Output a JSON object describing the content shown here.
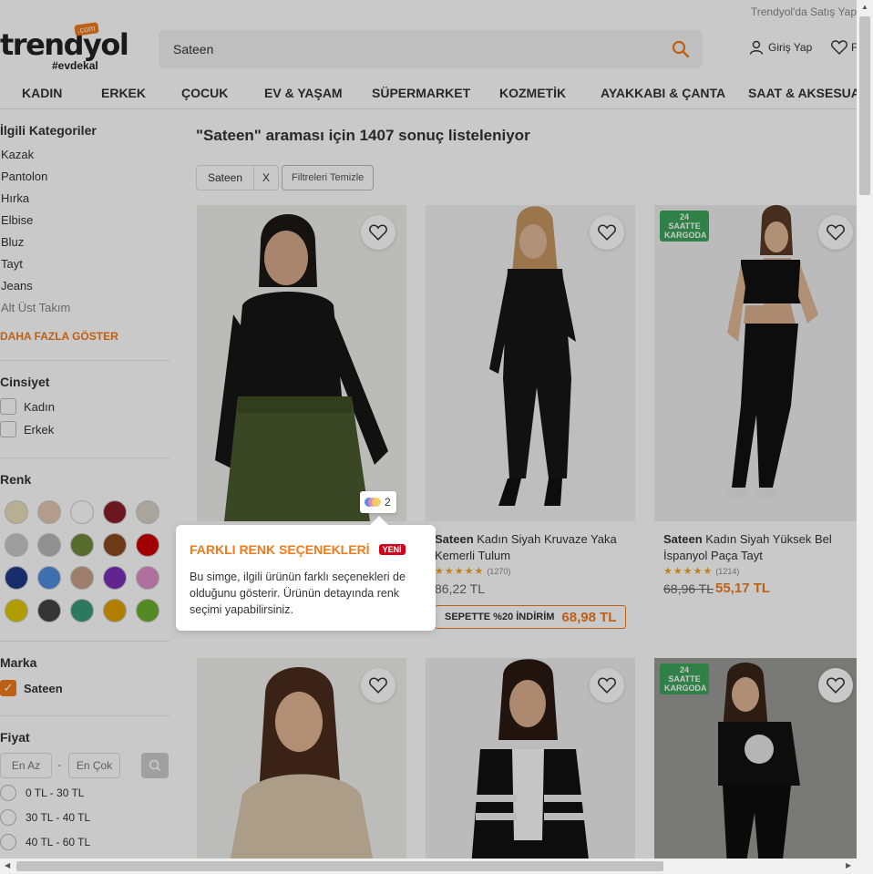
{
  "header": {
    "seller_link": "Trendyol'da Satış Yap",
    "logo": {
      "word": "trendyol",
      "com": ".com",
      "tag": "#evdekal"
    },
    "search_value": "Sateen",
    "login_label": "Giriş Yap",
    "favorites_label": "F"
  },
  "nav": [
    "KADIN",
    "ERKEK",
    "ÇOCUK",
    "EV & YAŞAM",
    "SÜPERMARKET",
    "KOZMETİK",
    "AYAKKABI & ÇANTA",
    "SAAT & AKSESUAR"
  ],
  "sidebar": {
    "categories_title": "İlgili Kategoriler",
    "categories": [
      "Kazak",
      "Pantolon",
      "Hırka",
      "Elbise",
      "Bluz",
      "Tayt",
      "Jeans",
      "Alt Üst Takım"
    ],
    "more_label": "DAHA FAZLA GÖSTER",
    "gender_title": "Cinsiyet",
    "genders": [
      "Kadın",
      "Erkek"
    ],
    "color_title": "Renk",
    "colors": [
      "#e8dfb8",
      "#e3c6b2",
      "#ffffff",
      "#8a1f2b",
      "#d8d2c6",
      "#c9c9c9",
      "#b8b8b8",
      "#6f8a3a",
      "#8a4a1c",
      "#cc0000",
      "#1f3a8a",
      "#4f8fe0",
      "#c8a08a",
      "#7a2fb8",
      "#e08fc8",
      "#e0c800",
      "#444444",
      "#3a9a7a",
      "#e0a000",
      "#6ab02e"
    ],
    "brand_title": "Marka",
    "brand": "Sateen",
    "price_title": "Fiyat",
    "price_min": "En Az",
    "price_sep": "-",
    "price_max": "En Çok",
    "price_ranges": [
      "0 TL - 30 TL",
      "30 TL - 40 TL",
      "40 TL - 60 TL"
    ]
  },
  "main": {
    "result_title": "\"Sateen\" araması için 1407 sonuç listeleniyor",
    "chip_label": "Sateen",
    "chip_close": "X",
    "clear_label": "Filtreleri Temizle"
  },
  "products": [
    {
      "brand": "",
      "name": "",
      "color_count": "2"
    },
    {
      "brand": "Sateen",
      "name": "Kadın Siyah Kruvaze Yaka Kemerli Tulum",
      "stars": "★★★★★",
      "reviews": "(1270)",
      "price": "86,22 TL",
      "basket_label": "SEPETTE %20 İNDİRİM",
      "basket_price": "68,98 TL"
    },
    {
      "brand": "Sateen",
      "name": "Kadın Siyah Yüksek Bel İspanyol Paça Tayt",
      "stars": "★★★★★",
      "reviews": "(1214)",
      "old_price": "68,96 TL",
      "new_price": "55,17 TL",
      "badge": "24 SAATTE KARGODA"
    },
    {
      "badge": ""
    },
    {
      "badge": ""
    },
    {
      "badge": "24 SAATTE KARGODA"
    }
  ],
  "tooltip": {
    "title": "FARKLI RENK SEÇENEKLERİ",
    "new_label": "YENİ",
    "body": "Bu simge, ilgili ürünün farklı seçenekleri de olduğunu gösterir. Ürünün detayında renk seçimi yapabilirsiniz."
  }
}
